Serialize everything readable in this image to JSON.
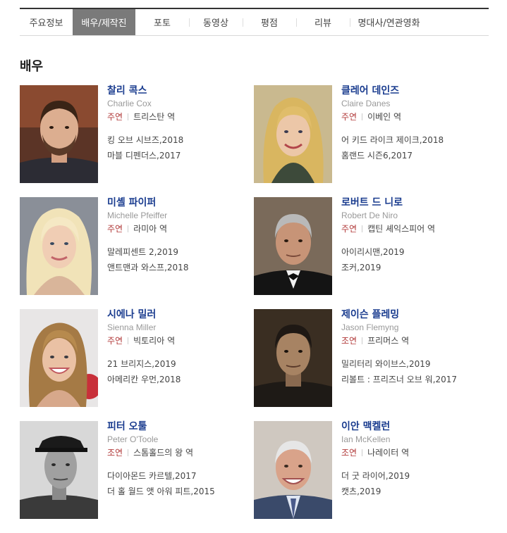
{
  "tabs": [
    {
      "label": "주요정보",
      "active": false
    },
    {
      "label": "배우/제작진",
      "active": true
    },
    {
      "label": "포토",
      "active": false
    },
    {
      "label": "동영상",
      "active": false
    },
    {
      "label": "평점",
      "active": false
    },
    {
      "label": "리뷰",
      "active": false
    },
    {
      "label": "명대사/연관영화",
      "active": false
    }
  ],
  "section_title": "배우",
  "actors": [
    {
      "name_ko": "찰리 콕스",
      "name_en": "Charlie Cox",
      "role_type": "주연",
      "role": "트리스탄 역",
      "films": [
        "킹 오브 시브즈,2018",
        "마블 디펜더스,2017"
      ],
      "photo_icon": "portrait-man-beard"
    },
    {
      "name_ko": "클레어 데인즈",
      "name_en": "Claire Danes",
      "role_type": "주연",
      "role": "이베인 역",
      "films": [
        "어 키드 라이크 제이크,2018",
        "홈랜드 시즌6,2017"
      ],
      "photo_icon": "portrait-woman-blonde"
    },
    {
      "name_ko": "미셸 파이퍼",
      "name_en": "Michelle Pfeiffer",
      "role_type": "주연",
      "role": "라미아 역",
      "films": [
        "말레피센트 2,2019",
        "앤트맨과 와스프,2018"
      ],
      "photo_icon": "portrait-woman-platinum"
    },
    {
      "name_ko": "로버트 드 니로",
      "name_en": "Robert De Niro",
      "role_type": "주연",
      "role": "캡틴 셰익스피어 역",
      "films": [
        "아이리시맨,2019",
        "조커,2019"
      ],
      "photo_icon": "portrait-man-tuxedo"
    },
    {
      "name_ko": "시에나 밀러",
      "name_en": "Sienna Miller",
      "role_type": "주연",
      "role": "빅토리아 역",
      "films": [
        "21 브리지스,2019",
        "아메리칸 우먼,2018"
      ],
      "photo_icon": "portrait-woman-smile"
    },
    {
      "name_ko": "제이슨 플레밍",
      "name_en": "Jason Flemyng",
      "role_type": "조연",
      "role": "프리머스 역",
      "films": [
        "밀리터리 와이브스,2019",
        "리볼트 : 프리즈너 오브 워,2017"
      ],
      "photo_icon": "portrait-man-dark"
    },
    {
      "name_ko": "피터 오툴",
      "name_en": "Peter O'Toole",
      "role_type": "조연",
      "role": "스톰홀드의 왕 역",
      "films": [
        "다이아몬드 카르텔,2017",
        "더 홀 월드 앳 아워 피트,2015"
      ],
      "photo_icon": "portrait-man-bw"
    },
    {
      "name_ko": "이안 맥켈런",
      "name_en": "Ian McKellen",
      "role_type": "조연",
      "role": "나레이터 역",
      "films": [
        "더 굿 라이어,2019",
        "캣츠,2019"
      ],
      "photo_icon": "portrait-man-elder"
    }
  ]
}
